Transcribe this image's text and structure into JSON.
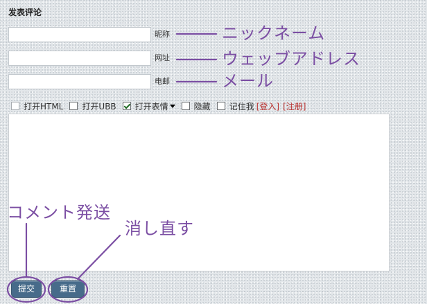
{
  "form": {
    "title": "发表评论",
    "fields": [
      {
        "label": "昵称",
        "value": "",
        "annotation": "ニックネーム"
      },
      {
        "label": "网址",
        "value": "",
        "annotation": "ウェッブアドレス"
      },
      {
        "label": "电邮",
        "value": "",
        "annotation": "メール"
      }
    ],
    "options": [
      {
        "label": "打开HTML",
        "checked": false
      },
      {
        "label": "打开UBB",
        "checked": false
      },
      {
        "label": "打开表情",
        "checked": true,
        "icon": "caret-down-icon"
      },
      {
        "label": "隐藏",
        "checked": false
      },
      {
        "label": "记住我",
        "checked": false
      }
    ],
    "login_link": "[登入]",
    "register_link": "[注册]",
    "comment_text": "",
    "submit_label": "提交",
    "reset_label": "重置"
  },
  "annotations": {
    "submit_note": "コメント発送",
    "reset_note": "消し直す"
  },
  "colors": {
    "annotation": "#7b4ea3",
    "link": "#b8312f",
    "button": "#476b8a",
    "page_background": "#e3e7ea"
  }
}
